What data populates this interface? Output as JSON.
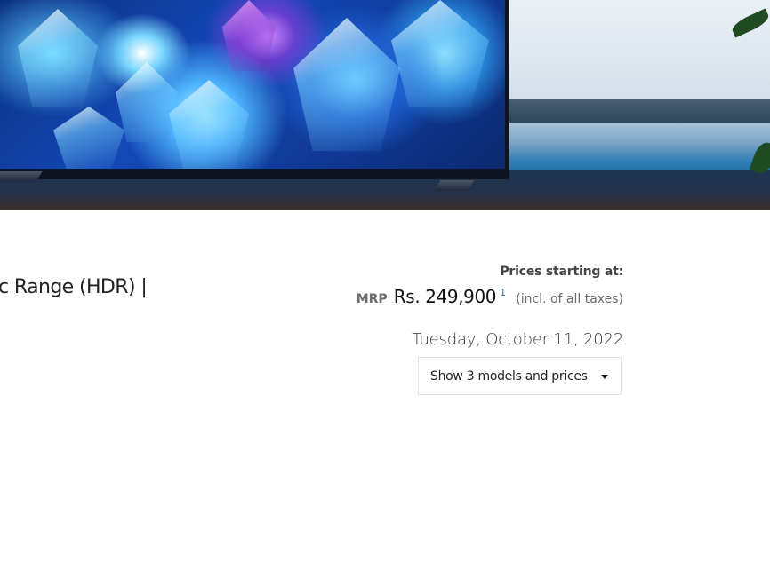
{
  "hero": {
    "image_description_icon": "tv-hero-image"
  },
  "product": {
    "title_fragment": "c Range (HDR) |"
  },
  "pricing": {
    "starting_label": "Prices starting at:",
    "mrp_label": "MRP",
    "price": "Rs. 249,900",
    "footnote": "1",
    "tax_note": "(incl. of all taxes)",
    "date": "Tuesday, October 11, 2022"
  },
  "models_dropdown": {
    "label": "Show 3 models and prices",
    "icon": "caret-down-icon"
  },
  "colors": {
    "footnote_link": "#2a6fb5",
    "text_primary": "#222222",
    "text_secondary": "#6b6b6b",
    "dropdown_border": "#e2e2e2"
  }
}
